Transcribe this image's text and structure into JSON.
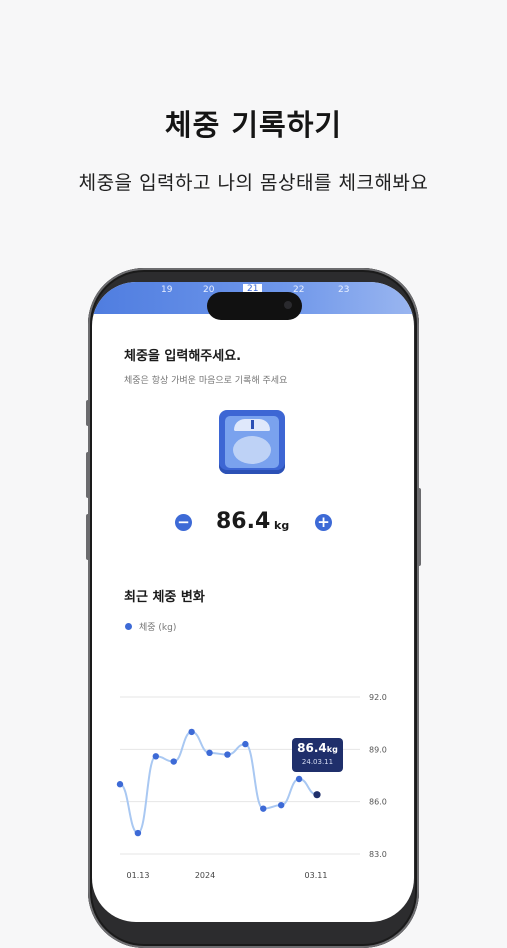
{
  "header": {
    "title": "체중 기록하기",
    "subtitle": "체중을 입력하고 나의 몸상태를 체크해봐요"
  },
  "date_strip": [
    "19",
    "20",
    "21",
    "22",
    "23"
  ],
  "colors": {
    "accent": "#3d6ad6",
    "tooltip": "#1f2f6b",
    "line": "#a9c8f2"
  },
  "weight_card": {
    "title": "체중을 입력해주세요.",
    "subtitle": "체중은 항상 가벼운 마음으로 기록해 주세요",
    "value": "86.4",
    "unit": "kg",
    "minus_icon": "minus-icon",
    "plus_icon": "plus-icon"
  },
  "chart_section": {
    "title": "최근 체중 변화"
  },
  "chart_data": {
    "type": "line",
    "legend": [
      "체중 (kg)"
    ],
    "series": [
      {
        "name": "체중 (kg)",
        "values": [
          87.0,
          84.2,
          88.6,
          88.3,
          90.0,
          88.8,
          88.7,
          89.3,
          85.6,
          85.8,
          87.3,
          86.4
        ]
      }
    ],
    "x_tick_labels": [
      "01.13",
      "2024",
      "03.11"
    ],
    "y_tick_labels": [
      "92.0",
      "89.0",
      "86.0",
      "83.0"
    ],
    "ylim": [
      83,
      92
    ],
    "grid": true,
    "tooltip": {
      "value": "86.4",
      "unit": "kg",
      "date": "24.03.11"
    }
  }
}
